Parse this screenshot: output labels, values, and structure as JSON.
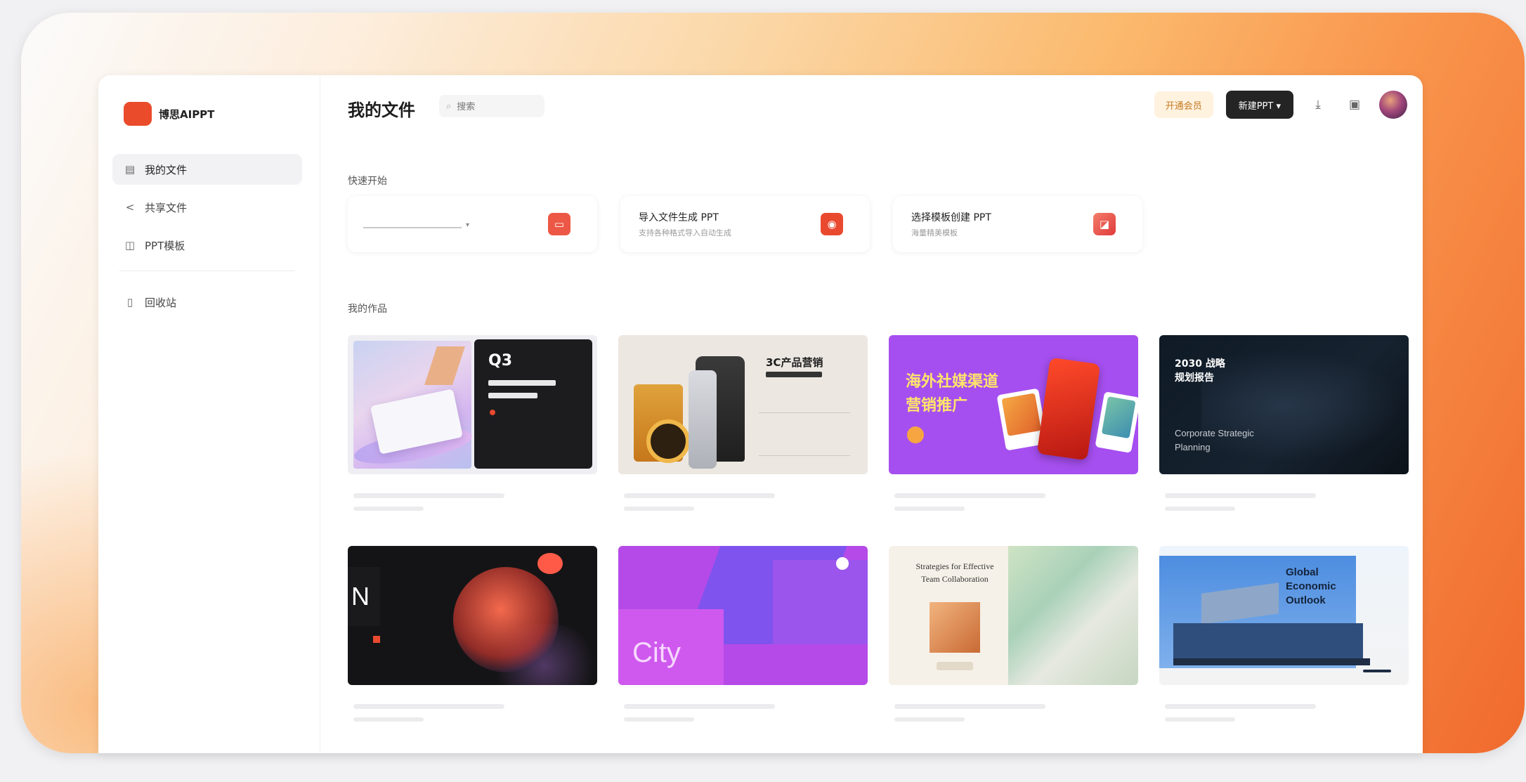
{
  "colors": {
    "brand": "#ea4b2b",
    "accent_soft": "#fff2df",
    "dark_button": "#242424",
    "frame_gradient_start": "#fdeede",
    "frame_gradient_end": "#f06a2d"
  },
  "brand": {
    "logo_text": "",
    "name": "博思AIPPT",
    "icon": "brand-logo-icon"
  },
  "sidebar": {
    "items": [
      {
        "label": "我的文件",
        "icon": "file-icon",
        "active": true
      },
      {
        "label": "共享文件",
        "icon": "share-icon",
        "active": false
      },
      {
        "label": "PPT模板",
        "icon": "template-icon",
        "active": false
      },
      {
        "label": "回收站",
        "icon": "trash-icon",
        "active": false
      }
    ]
  },
  "header": {
    "title": "我的文件",
    "search_placeholder": "搜索",
    "vip_label": "开通会员",
    "new_button_label": "新建PPT ▾"
  },
  "quick_start": {
    "label": "快速开始",
    "cards": [
      {
        "title": "",
        "subtitle": "",
        "icon": "ai-generate-icon"
      },
      {
        "title": "导入文件生成 PPT",
        "subtitle": "支持各种格式导入自动生成",
        "icon": "import-file-icon"
      },
      {
        "title": "选择模板创建 PPT",
        "subtitle": "海量精美模板",
        "icon": "template-create-icon"
      }
    ]
  },
  "works": {
    "label": "我的作品",
    "thumbs": {
      "t1_q": "Q3",
      "t2_title": "3C产品营销",
      "t3_line1": "海外社媒渠道",
      "t3_line2": "营销推广",
      "t4_h1": "2030 战略",
      "t4_h2": "规划报告",
      "t4_en1": "Corporate Strategic",
      "t4_en2": "Planning",
      "t5_n": "N",
      "t6_city": "City",
      "t7_title": "Strategies for Effective Team Collaboration",
      "t8_title_1": "Global",
      "t8_title_2": "Economic",
      "t8_title_3": "Outlook"
    }
  }
}
